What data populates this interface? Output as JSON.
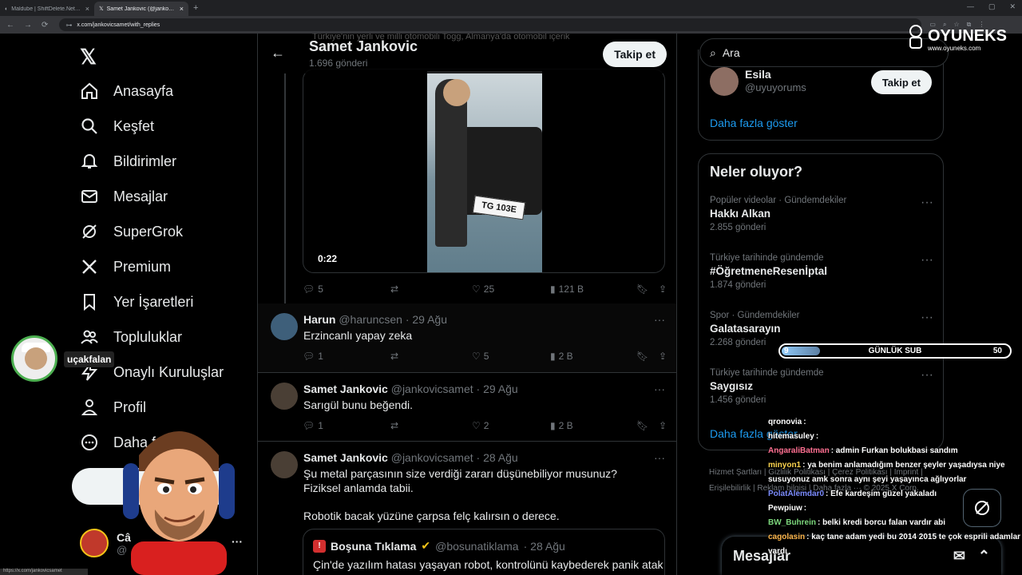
{
  "browser": {
    "tabs": [
      {
        "title": "Maldube | ShiftDelete.Net Forum",
        "active": false
      },
      {
        "title": "Samet Jankovic (@jankovicsamet)",
        "active": true
      }
    ],
    "url": "x.com/jankovicsamet/with_replies",
    "status_url": "https://x.com/jankovicsamet"
  },
  "sidebar": {
    "logo": "𝕏",
    "items": [
      {
        "label": "Anasayfa",
        "icon": "home-icon"
      },
      {
        "label": "Keşfet",
        "icon": "search-icon"
      },
      {
        "label": "Bildirimler",
        "icon": "bell-icon"
      },
      {
        "label": "Mesajlar",
        "icon": "mail-icon"
      },
      {
        "label": "SuperGrok",
        "icon": "grok-icon"
      },
      {
        "label": "Premium",
        "icon": "x-icon"
      },
      {
        "label": "Yer İşaretleri",
        "icon": "bookmark-icon"
      },
      {
        "label": "Topluluklar",
        "icon": "people-icon"
      },
      {
        "label": "Onaylı Kuruluşlar",
        "icon": "lightning-icon"
      },
      {
        "label": "Profil",
        "icon": "person-icon"
      },
      {
        "label": "Daha f",
        "icon": "more-circle-icon"
      }
    ],
    "post_button": "Gö",
    "account_name": "Câ",
    "account_handle": "@"
  },
  "header": {
    "back": "←",
    "name": "Samet Jankovic",
    "count": "1.696 gönderi",
    "follow": "Takip et",
    "behind_text": "Türkiye'nin yerli ve milli otomobili Togg, Almanya'da otomobil içerik"
  },
  "video": {
    "time": "0:22",
    "plate": "TG 103E",
    "actions": {
      "replies": "5",
      "reposts": "",
      "likes": "25",
      "views": "121 B"
    }
  },
  "posts": [
    {
      "name": "Harun",
      "handle": "@haruncsen",
      "date": "· 29 Ağu",
      "text": "Erzincanlı yapay zeka",
      "replies": "1",
      "reposts": "",
      "likes": "5",
      "views": "2 B"
    },
    {
      "name": "Samet Jankovic",
      "handle": "@jankovicsamet",
      "date": "· 29 Ağu",
      "text": "Sarıgül bunu beğendi.",
      "replies": "1",
      "reposts": "",
      "likes": "2",
      "views": "2 B"
    },
    {
      "name": "Samet Jankovic",
      "handle": "@jankovicsamet",
      "date": "· 28 Ağu",
      "text": "Şu metal parçasının size verdiği zararı düşünebiliyor musunuz? Fiziksel anlamda tabii.",
      "text2": "Robotik bacak yüzüne çarpsa felç kalırsın o derece."
    }
  ],
  "quote": {
    "name": "Boşuna Tıklama",
    "handle": "@bosunatiklama",
    "date": "· 28 Ağu",
    "text": "Çin'de yazılım hatası yaşayan robot, kontrolünü kaybederek panik atak"
  },
  "right": {
    "search_placeholder": "Ara",
    "who_to_follow": {
      "name": "Esila",
      "handle": "@uyuyorums",
      "button": "Takip et",
      "show_more": "Daha fazla göster"
    },
    "trends_title": "Neler oluyor?",
    "trends": [
      {
        "context": "Popüler videolar · Gündemdekiler",
        "name": "Hakkı Alkan",
        "posts": "2.855 gönderi"
      },
      {
        "context": "Türkiye tarihinde gündemde",
        "name": "#ÖğretmeneResenİptal",
        "posts": "1.874 gönderi"
      },
      {
        "context": "Spor · Gündemdekiler",
        "name": "Galatasarayın",
        "posts": "2.268 gönderi"
      },
      {
        "context": "Türkiye tarihinde gündemde",
        "name": "Saygısız",
        "posts": "1.456 gönderi"
      }
    ],
    "trends_more": "Daha fazla göster",
    "footer": "Hizmet Şartları | Gizlilik Politikası | Çerez Politikası | Imprint | Erişilebilirlik | Reklam bilgisi | Daha fazla ··· © 2025 X Corp.",
    "messages": "Mesajlar"
  },
  "overlay": {
    "brand": "OYUNEKS",
    "brand_sub": "www.oyuneks.com",
    "sub_goal": {
      "current": "9",
      "label": "GÜNLÜK SUB",
      "target": "50",
      "progress": 0.18
    },
    "camera_label": "uçakfalan",
    "chat": [
      {
        "user": "qronovia",
        "msg": "",
        "color": "#ffffff"
      },
      {
        "user": "hitemasuley",
        "msg": "",
        "color": "#ffffff"
      },
      {
        "user": "AngaraliBatman",
        "msg": "admin Furkan bolukbasi sandım",
        "color": "#ff6f91"
      },
      {
        "user": "minyon1",
        "msg": "ya benim anlamadığım benzer şeyler yaşadıysa niye susuyonuz amk sonra aynı şeyi yaşayınca ağlıyorlar",
        "color": "#ffd54f"
      },
      {
        "user": "PolatAlemdar0",
        "msg": "Efe kardeşim güzel yakaladı",
        "color": "#7c8cff"
      },
      {
        "user": "Pewpiuw",
        "msg": "",
        "color": "#ffffff"
      },
      {
        "user": "BW_Buhrein",
        "msg": "belki kredi borcu falan vardır abi",
        "color": "#7cd67c"
      },
      {
        "user": "cagolasin",
        "msg": "kaç tane adam yedi bu 2014 2015 te çok esprili adamlar vardı",
        "color": "#ffb74d"
      }
    ]
  }
}
